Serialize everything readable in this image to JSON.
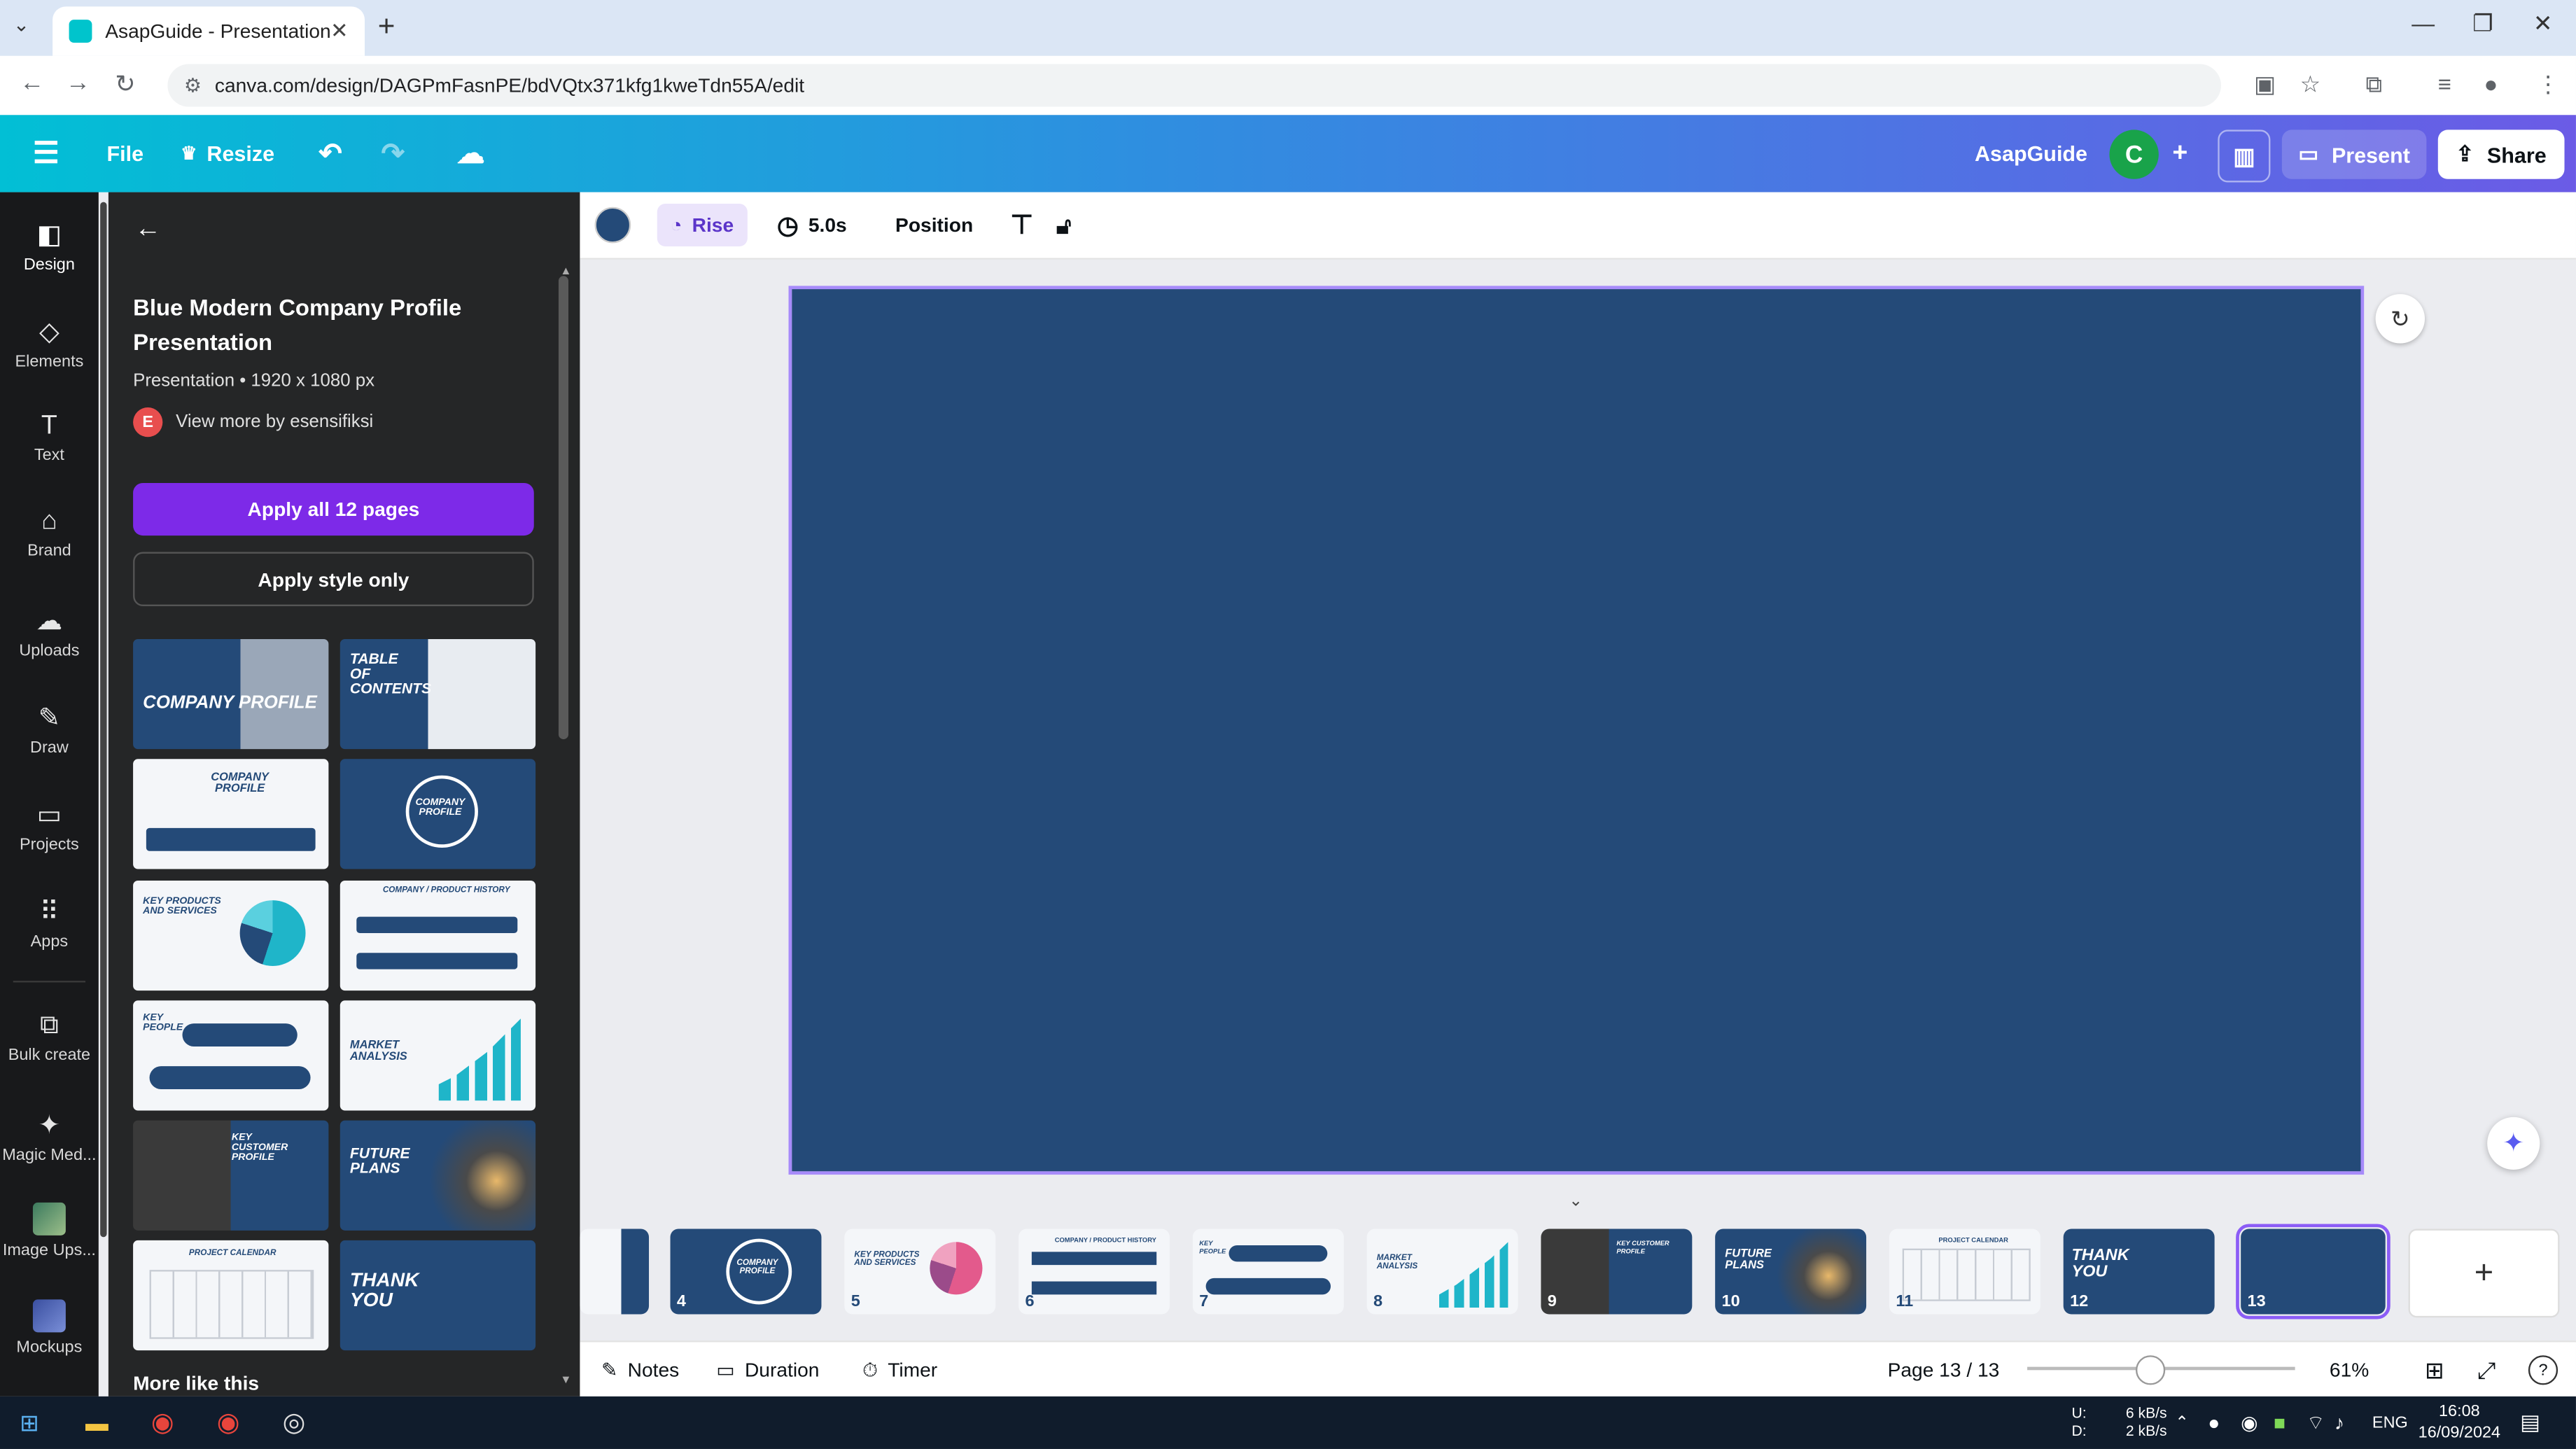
{
  "browser": {
    "tab_title": "AsapGuide - Presentation",
    "url": "canva.com/design/DAGPmFasnPE/bdVQtx371kfg1kweTdn55A/edit"
  },
  "topbar": {
    "file": "File",
    "resize": "Resize",
    "team_name": "AsapGuide",
    "avatar_letter": "C",
    "present": "Present",
    "share": "Share"
  },
  "leftnav": [
    {
      "label": "Design",
      "icon": "design-icon"
    },
    {
      "label": "Elements",
      "icon": "elements-icon"
    },
    {
      "label": "Text",
      "icon": "text-icon"
    },
    {
      "label": "Brand",
      "icon": "brand-icon"
    },
    {
      "label": "Uploads",
      "icon": "uploads-icon"
    },
    {
      "label": "Draw",
      "icon": "draw-icon"
    },
    {
      "label": "Projects",
      "icon": "projects-icon"
    },
    {
      "label": "Apps",
      "icon": "apps-icon"
    },
    {
      "label": "Bulk create",
      "icon": "bulk-create-icon"
    },
    {
      "label": "Magic Med...",
      "icon": "magic-media-icon"
    },
    {
      "label": "Image Ups...",
      "icon": "image-upscaler-icon"
    },
    {
      "label": "Mockups",
      "icon": "mockups-icon"
    }
  ],
  "panel": {
    "title": "Blue Modern Company Profile Presentation",
    "meta": "Presentation • 1920 x 1080 px",
    "author_initial": "E",
    "author_text": "View more by esensifiksi",
    "apply_all": "Apply all 12 pages",
    "apply_style": "Apply style only",
    "templates": [
      "COMPANY PROFILE",
      "TABLE OF CONTENTS",
      "COMPANY PROFILE",
      "COMPANY PROFILE",
      "KEY PRODUCTS AND SERVICES",
      "COMPANY / PRODUCT HISTORY",
      "KEY PEOPLE",
      "MARKET ANALYSIS",
      "KEY CUSTOMER PROFILE",
      "FUTURE PLANS",
      "PROJECT CALENDAR",
      "THANK YOU"
    ],
    "more_like_this": "More like this"
  },
  "context_toolbar": {
    "animation": "Rise",
    "duration": "5.0s",
    "position": "Position"
  },
  "filmstrip": [
    {
      "n": "",
      "caption": ""
    },
    {
      "n": "4",
      "caption": "COMPANY PROFILE"
    },
    {
      "n": "5",
      "caption": "KEY PRODUCTS AND SERVICES"
    },
    {
      "n": "6",
      "caption": "COMPANY / PRODUCT HISTORY"
    },
    {
      "n": "7",
      "caption": "KEY PEOPLE"
    },
    {
      "n": "8",
      "caption": "MARKET ANALYSIS"
    },
    {
      "n": "9",
      "caption": "KEY CUSTOMER PROFILE"
    },
    {
      "n": "10",
      "caption": "FUTURE PLANS"
    },
    {
      "n": "11",
      "caption": "PROJECT CALENDAR"
    },
    {
      "n": "12",
      "caption": "THANK YOU"
    },
    {
      "n": "13",
      "caption": ""
    }
  ],
  "bottom": {
    "notes": "Notes",
    "duration": "Duration",
    "timer": "Timer",
    "page_indicator": "Page 13 / 13",
    "zoom": "61%"
  },
  "taskbar": {
    "net_up_label": "U:",
    "net_down_label": "D:",
    "net_up": "6 kB/s",
    "net_down": "2 kB/s",
    "lang": "ENG",
    "time": "16:08",
    "date": "16/09/2024"
  },
  "colors": {
    "slide_bg": "#244a78",
    "accent": "#7d2ae8",
    "canva_gradient_start": "#02bfd5",
    "canva_gradient_end": "#6b5be6"
  }
}
